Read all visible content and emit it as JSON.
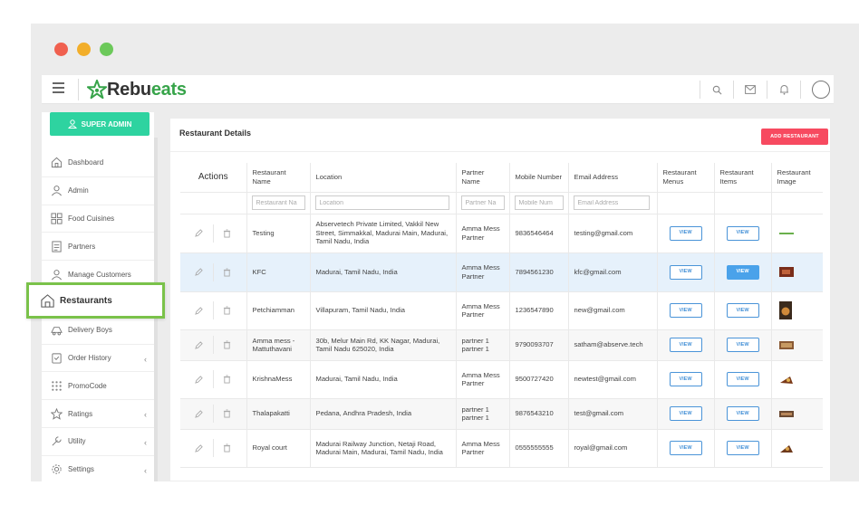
{
  "brand": {
    "name_part1": "Rebu",
    "name_part2": "eats"
  },
  "sidebar": {
    "role_label": "SUPER ADMIN",
    "items": [
      {
        "label": "Dashboard",
        "icon": "home-icon"
      },
      {
        "label": "Admin",
        "icon": "user-icon"
      },
      {
        "label": "Food Cuisines",
        "icon": "grid-icon"
      },
      {
        "label": "Partners",
        "icon": "document-icon"
      },
      {
        "label": "Manage Customers",
        "icon": "users-icon"
      },
      {
        "label": "Restaurants",
        "icon": "house-icon",
        "active": true
      },
      {
        "label": "Delivery Boys",
        "icon": "delivery-icon"
      },
      {
        "label": "Order History",
        "icon": "clipboard-icon",
        "expandable": true
      },
      {
        "label": "PromoCode",
        "icon": "dots-grid-icon"
      },
      {
        "label": "Ratings",
        "icon": "star-icon",
        "expandable": true
      },
      {
        "label": "Utility",
        "icon": "tools-icon",
        "expandable": true
      },
      {
        "label": "Settings",
        "icon": "gear-icon",
        "expandable": true
      }
    ]
  },
  "main": {
    "title": "Restaurant Details",
    "add_button": "ADD RESTAURANT",
    "columns": {
      "actions": "Actions",
      "name": "Restaurant Name",
      "location": "Location",
      "partner": "Partner Name",
      "mobile": "Mobile Number",
      "email": "Email Address",
      "menus": "Restaurant Menus",
      "items": "Restaurant Items",
      "image": "Restaurant Image"
    },
    "filters": {
      "name": "Restaurant Na",
      "location": "Location",
      "partner": "Partner Na",
      "mobile": "Mobile Num",
      "email": "Email Address"
    },
    "view_label": "VIEW",
    "rows": [
      {
        "name": "Testing",
        "location": "Abservetech Private Limited, Vakkil New Street, Simmakkal, Madurai Main, Madurai, Tamil Nadu, India",
        "partner": "Amma Mess Partner",
        "mobile": "9836546464",
        "email": "testing@gmail.com"
      },
      {
        "name": "KFC",
        "location": "Madurai, Tamil Nadu, India",
        "partner": "Amma Mess Partner",
        "mobile": "7894561230",
        "email": "kfc@gmail.com"
      },
      {
        "name": "Petchiamman",
        "location": "Villapuram, Tamil Nadu, India",
        "partner": "Amma Mess Partner",
        "mobile": "1236547890",
        "email": "new@gmail.com"
      },
      {
        "name": "Amma mess - Mattuthavani",
        "location": "30b, Melur Main Rd, KK Nagar, Madurai, Tamil Nadu 625020, India",
        "partner": "partner 1 partner 1",
        "mobile": "9790093707",
        "email": "satham@abserve.tech"
      },
      {
        "name": "KrishnaMess",
        "location": "Madurai, Tamil Nadu, India",
        "partner": "Amma Mess Partner",
        "mobile": "9500727420",
        "email": "newtest@gmail.com"
      },
      {
        "name": "Thalapakatti",
        "location": "Pedana, Andhra Pradesh, India",
        "partner": "partner 1 partner 1",
        "mobile": "9876543210",
        "email": "test@gmail.com"
      },
      {
        "name": "Royal court",
        "location": "Madurai Railway Junction, Netaji Road, Madurai Main, Madurai, Tamil Nadu, India",
        "partner": "Amma Mess Partner",
        "mobile": "0555555555",
        "email": "royal@gmail.com"
      }
    ]
  },
  "colors": {
    "brand_green": "#37a44a",
    "super_admin_bg": "#2ed3a0",
    "add_button_bg": "#f74a60",
    "view_border": "#4a94d8",
    "highlight_border": "#7ac24a"
  }
}
